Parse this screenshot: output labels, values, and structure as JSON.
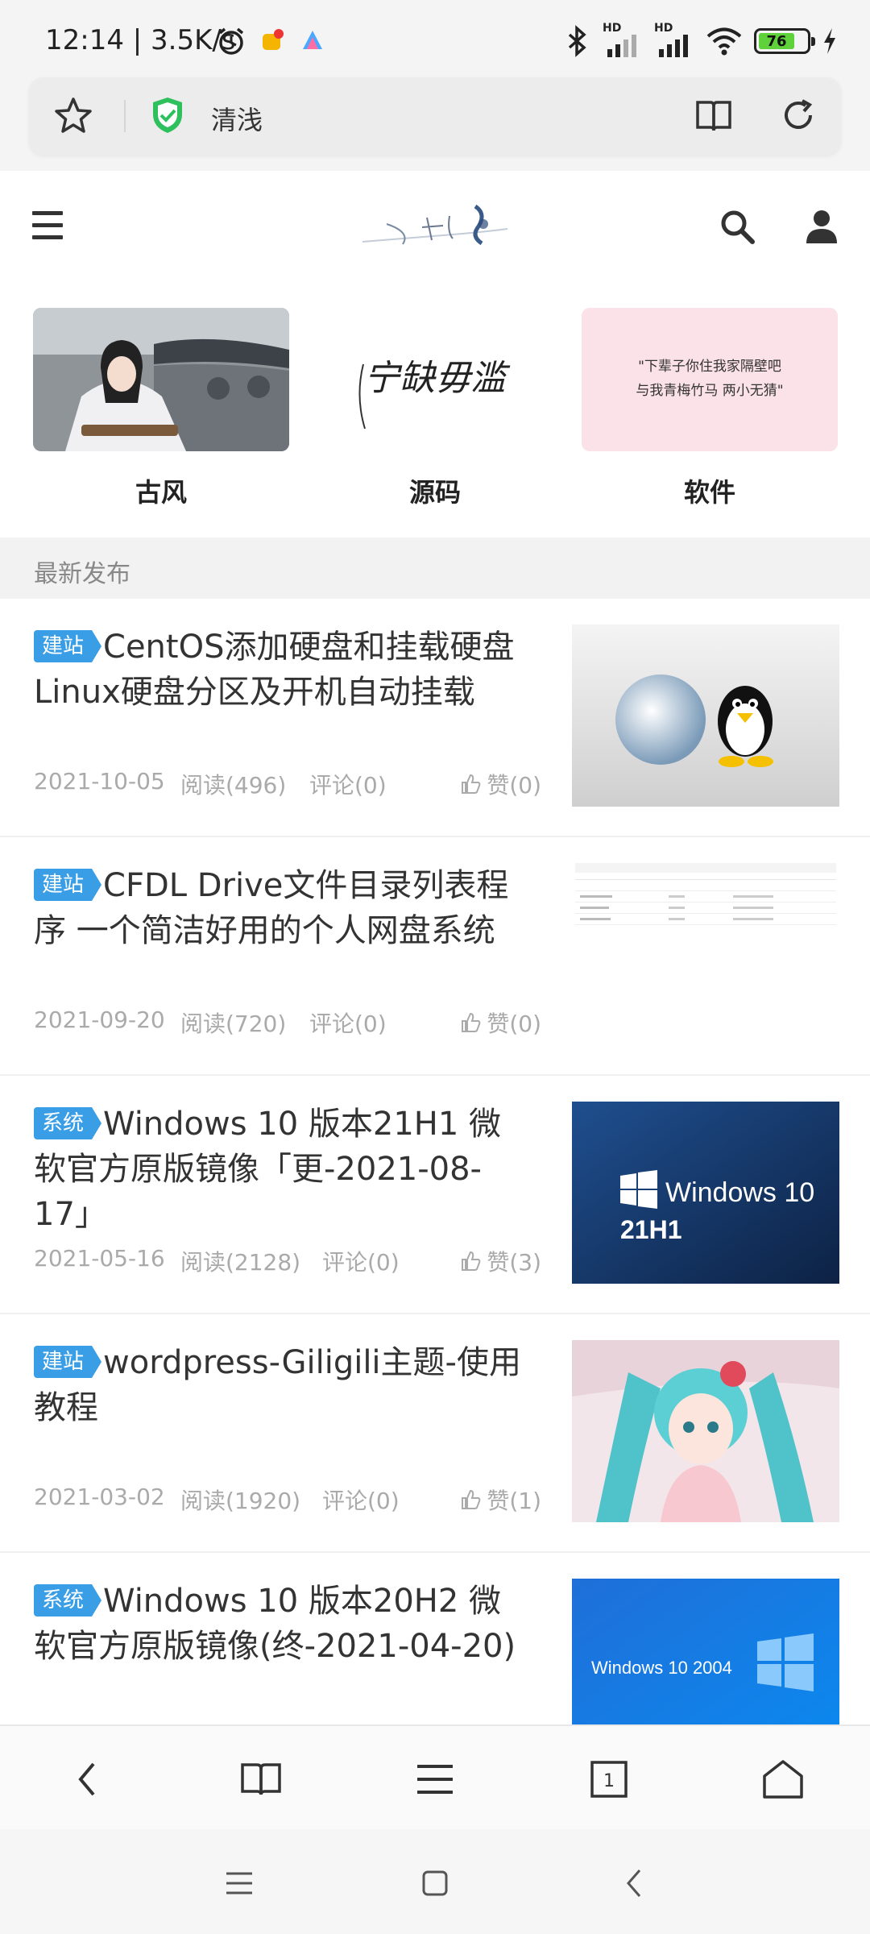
{
  "status_bar": {
    "time": "12:14 | 3.5K/s",
    "battery": "76",
    "icons": [
      "alarm-icon",
      "app-badge-icon",
      "app-icon",
      "bluetooth-icon",
      "signal-hd-1-icon",
      "signal-hd-2-icon",
      "wifi-icon",
      "battery-icon",
      "charging-icon"
    ]
  },
  "address_bar": {
    "site_name": "清浅",
    "icons": [
      "star-icon",
      "shield-check-icon",
      "reader-book-icon",
      "reload-icon"
    ],
    "shield_color": "#2ec05c"
  },
  "header": {
    "icons": [
      "menu-icon",
      "site-logo",
      "search-icon",
      "user-icon"
    ]
  },
  "categories": [
    {
      "label": "古风"
    },
    {
      "label": "源码"
    },
    {
      "label": "软件"
    }
  ],
  "category_images": {
    "yuanma_calligraphy": "宁缺毋滥",
    "ruanjian_quote_line1": "\"下辈子你住我家隔壁吧",
    "ruanjian_quote_line2": "与我青梅竹马 两小无猜\""
  },
  "section": {
    "title": "最新发布"
  },
  "articles": [
    {
      "tag": "建站",
      "title": "CentOS添加硬盘和挂载硬盘Linux硬盘分区及开机自动挂载",
      "date": "2021-10-05",
      "read": "阅读(496)",
      "comment": "评论(0)",
      "like": "赞(0)"
    },
    {
      "tag": "建站",
      "title": "CFDL Drive文件目录列表程序 一个简洁好用的个人网盘系统",
      "date": "2021-09-20",
      "read": "阅读(720)",
      "comment": "评论(0)",
      "like": "赞(0)"
    },
    {
      "tag": "系统",
      "title": "Windows 10 版本21H1 微软官方原版镜像「更-2021-08-17」",
      "date": "2021-05-16",
      "read": "阅读(2128)",
      "comment": "评论(0)",
      "like": "赞(3)"
    },
    {
      "tag": "建站",
      "title": "wordpress-Giligili主题-使用教程",
      "date": "2021-03-02",
      "read": "阅读(1920)",
      "comment": "评论(0)",
      "like": "赞(1)"
    },
    {
      "tag": "系统",
      "title": "Windows 10 版本20H2 微软官方原版镜像(终-2021-04-20)",
      "date": "",
      "read": "",
      "comment": "",
      "like": ""
    }
  ],
  "thumbnail_text": {
    "win21h1_brand": "Windows 10",
    "win21h1_version": "21H1",
    "win2004": "Windows 10 2004"
  },
  "browser_nav": {
    "tabs_count": "1",
    "icons": [
      "back-icon",
      "bookmarks-icon",
      "menu-icon",
      "tabs-icon",
      "home-icon"
    ]
  },
  "system_nav": {
    "icons": [
      "recents-icon",
      "home-square-icon",
      "back-icon"
    ]
  },
  "colors": {
    "tag_blue": "#3a9ee6",
    "battery_green": "#5fd13a"
  }
}
